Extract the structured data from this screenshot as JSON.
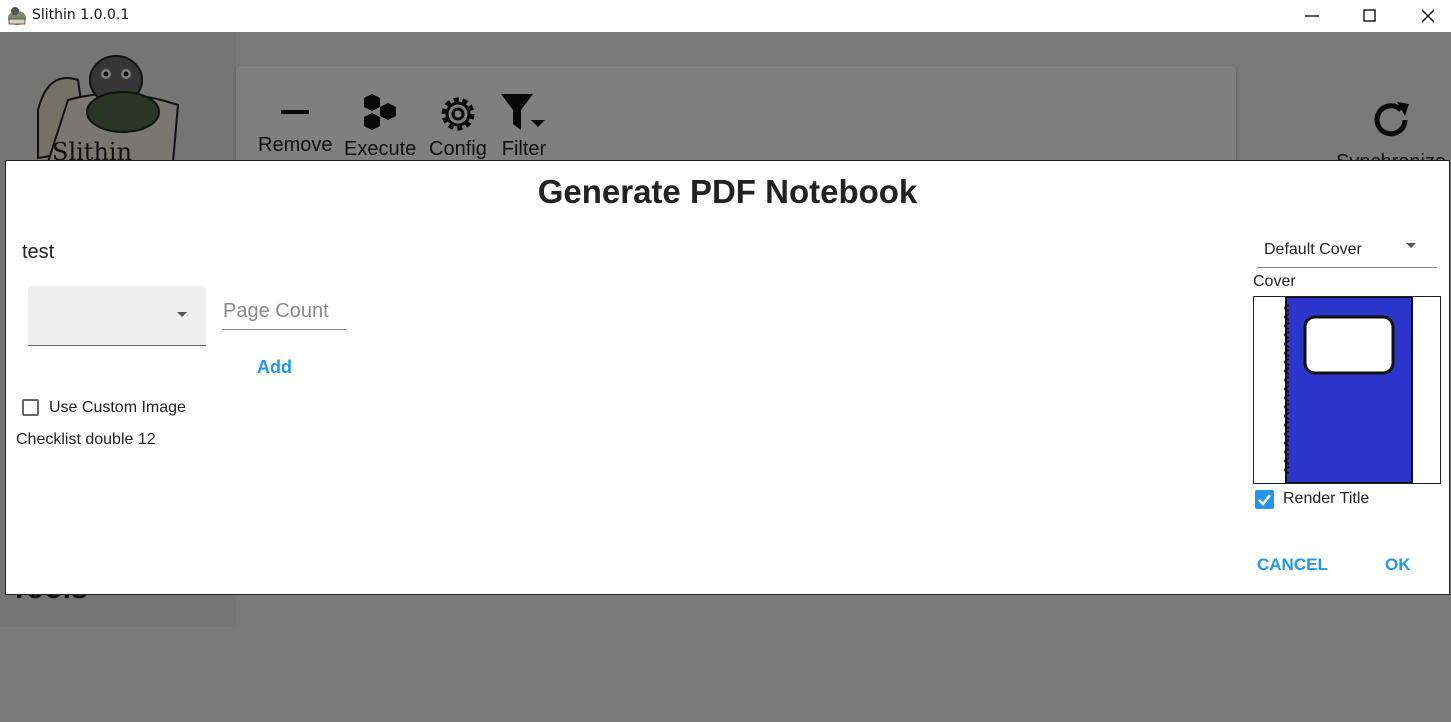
{
  "window": {
    "title": "Slithin 1.0.0.1"
  },
  "toolbar": {
    "remove_label": "Remove",
    "execute_label": "Execute",
    "config_label": "Config",
    "filter_label": "Filter",
    "sync_label": "Synchronize"
  },
  "sidebar": {
    "bottom_label": "Tools"
  },
  "dialog": {
    "title": "Generate PDF Notebook",
    "notebook_name": "test",
    "template_select_value": "",
    "page_count_placeholder": "Page Count",
    "add_label": "Add",
    "use_custom_image_label": "Use Custom Image",
    "use_custom_image_checked": false,
    "template_entries": [
      {
        "name": "Checklist double",
        "count": "12"
      }
    ],
    "cover_select_value": "Default Cover",
    "cover_label": "Cover",
    "render_title_label": "Render Title",
    "render_title_checked": true,
    "cancel_label": "CANCEL",
    "ok_label": "OK"
  },
  "colors": {
    "accent": "#2196f3",
    "cover_blue": "#2b35cc",
    "overlay": "rgba(0,0,0,0.5)"
  },
  "icons": {
    "app": "turtle-logo-icon",
    "remove": "minus-icon",
    "execute": "hexagon-cluster-icon",
    "config": "gear-icon",
    "filter": "filter-icon",
    "sync": "refresh-icon"
  }
}
